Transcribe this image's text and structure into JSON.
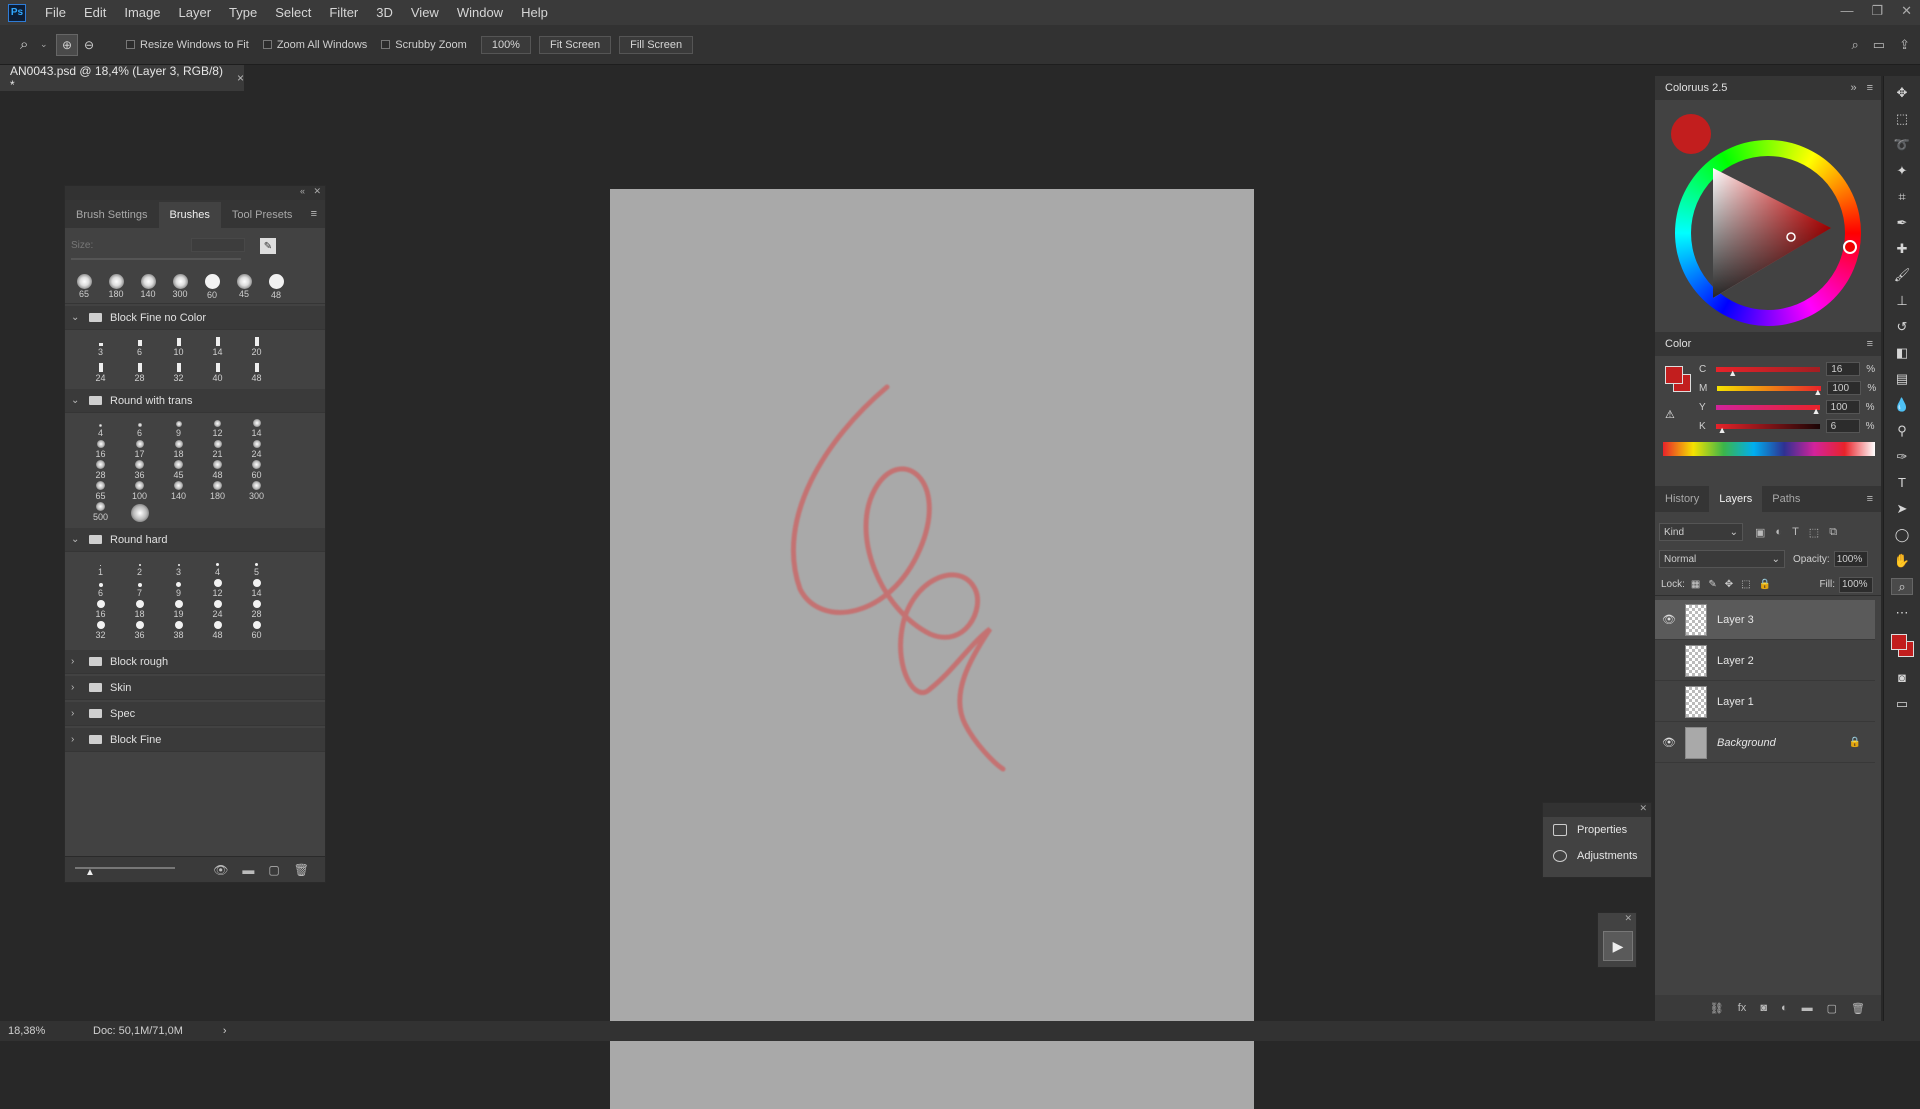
{
  "app": {
    "logo": "Ps"
  },
  "menu": [
    "File",
    "Edit",
    "Image",
    "Layer",
    "Type",
    "Select",
    "Filter",
    "3D",
    "View",
    "Window",
    "Help"
  ],
  "options": {
    "resize_windows": "Resize Windows to Fit",
    "zoom_all": "Zoom All Windows",
    "scrubby": "Scrubby Zoom",
    "zoom_value": "100%",
    "fit_screen": "Fit Screen",
    "fill_screen": "Fill Screen"
  },
  "document": {
    "tab_title": "AN0043.psd @ 18,4% (Layer 3, RGB/8) *",
    "close": "×"
  },
  "status": {
    "zoom": "18,38%",
    "doc": "Doc: 50,1M/71,0M",
    "arrow": "›"
  },
  "brushes": {
    "tabs": [
      "Brush Settings",
      "Brushes",
      "Tool Presets"
    ],
    "size_label": "Size:",
    "presets": [
      "65",
      "180",
      "140",
      "300",
      "60",
      "45",
      "48"
    ],
    "groups": [
      {
        "name": "Block Fine no Color",
        "items": [
          "3",
          "6",
          "10",
          "14",
          "20",
          "24",
          "28",
          "32",
          "40",
          "48"
        ]
      },
      {
        "name": "Round with trans",
        "items": [
          "4",
          "6",
          "9",
          "12",
          "14",
          "16",
          "17",
          "18",
          "21",
          "24",
          "28",
          "36",
          "45",
          "48",
          "60",
          "65",
          "100",
          "140",
          "180",
          "300",
          "500"
        ]
      },
      {
        "name": "Round hard",
        "items": [
          "1",
          "2",
          "3",
          "4",
          "5",
          "6",
          "7",
          "9",
          "12",
          "14",
          "16",
          "18",
          "19",
          "24",
          "28",
          "32",
          "36",
          "38",
          "48",
          "60"
        ]
      },
      {
        "name": "Block rough"
      },
      {
        "name": "Skin"
      },
      {
        "name": "Spec"
      },
      {
        "name": "Block Fine"
      }
    ]
  },
  "coloruus": {
    "title": "Coloruus 2.5",
    "primary_color": "#c21e1e"
  },
  "color_panel": {
    "title": "Color",
    "sliders": [
      {
        "label": "C",
        "value": "16",
        "unit": "%",
        "level": 0.16
      },
      {
        "label": "M",
        "value": "100",
        "unit": "%",
        "level": 1.0
      },
      {
        "label": "Y",
        "value": "100",
        "unit": "%",
        "level": 1.0
      },
      {
        "label": "K",
        "value": "6",
        "unit": "%",
        "level": 0.06
      }
    ]
  },
  "layers_panel": {
    "tabs": [
      "History",
      "Layers",
      "Paths"
    ],
    "kind": "Kind",
    "blend_mode": "Normal",
    "opacity_label": "Opacity:",
    "opacity_value": "100%",
    "lock_label": "Lock:",
    "fill_label": "Fill:",
    "fill_value": "100%",
    "layers": [
      {
        "name": "Layer 3",
        "visible": true,
        "selected": true
      },
      {
        "name": "Layer 2",
        "visible": false
      },
      {
        "name": "Layer 1",
        "visible": false
      },
      {
        "name": "Background",
        "visible": true,
        "locked": true
      }
    ]
  },
  "mini_panel": {
    "properties": "Properties",
    "adjustments": "Adjustments"
  }
}
